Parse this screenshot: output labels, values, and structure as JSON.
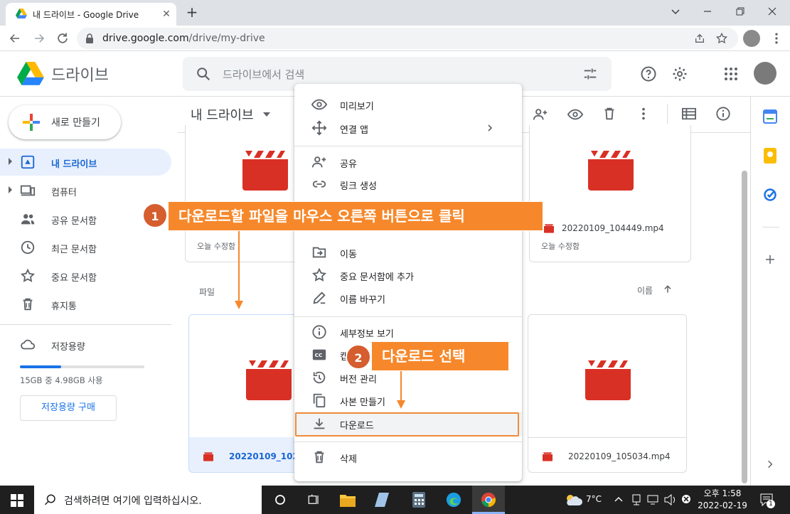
{
  "browser": {
    "tab_title": "내 드라이브 - Google Drive",
    "tab_close": "✕",
    "new_tab": "+",
    "url_host": "drive.google.com",
    "url_path": "/drive/my-drive"
  },
  "drive": {
    "logo_text": "드라이브",
    "search_placeholder": "드라이브에서 검색"
  },
  "sidebar": {
    "new_button": "새로 만들기",
    "items": [
      {
        "label": "내 드라이브",
        "icon": "my-drive-icon",
        "active": true
      },
      {
        "label": "컴퓨터",
        "icon": "computer-icon"
      },
      {
        "label": "공유 문서함",
        "icon": "shared-icon"
      },
      {
        "label": "최근 문서함",
        "icon": "clock-icon"
      },
      {
        "label": "중요 문서함",
        "icon": "star-icon"
      },
      {
        "label": "휴지통",
        "icon": "trash-icon"
      }
    ],
    "storage_label": "저장용량",
    "storage_text": "15GB 중 4.98GB 사용",
    "storage_fraction": 0.332,
    "buy_storage": "저장용량 구매"
  },
  "main": {
    "title": "내 드라이브",
    "section_label": "파일",
    "sort_label": "이름",
    "top_cards": [
      {
        "meta": "오늘 수정함"
      },
      {
        "name": "20220109_104449.mp4",
        "meta": "오늘 수정함"
      }
    ],
    "files": [
      {
        "name": "20220109_1021",
        "selected": true
      },
      {
        "name": "20220109_105034.mp4"
      }
    ]
  },
  "context_menu": {
    "items": [
      {
        "label": "미리보기",
        "icon": "eye-icon"
      },
      {
        "label": "연결 앱",
        "icon": "move-arrows-icon",
        "submenu": true
      },
      {
        "label": "공유",
        "icon": "person-add-icon"
      },
      {
        "label": "링크 생성",
        "icon": "link-icon"
      },
      {
        "label": "이동",
        "icon": "move-to-folder-icon"
      },
      {
        "label": "중요 문서함에 추가",
        "icon": "star-icon"
      },
      {
        "label": "이름 바꾸기",
        "icon": "pencil-icon"
      },
      {
        "label": "세부정보 보기",
        "icon": "info-icon"
      },
      {
        "label": "캡",
        "icon": "captions-icon"
      },
      {
        "label": "버전 관리",
        "icon": "history-icon"
      },
      {
        "label": "사본 만들기",
        "icon": "copy-icon"
      },
      {
        "label": "다운로드",
        "icon": "download-icon"
      },
      {
        "label": "삭제",
        "icon": "trash-icon"
      }
    ]
  },
  "annotations": {
    "step1_number": "1",
    "step1_text": "다운로드할 파일을 마우스 오른쪽 버튼으로 클릭",
    "step2_number": "2",
    "step2_text": "다운로드 선택",
    "accent_color": "#f6882b"
  },
  "taskbar": {
    "search_text": "검색하려면 여기에 입력하십시오.",
    "temperature": "7°C",
    "time": "오후 1:58",
    "date": "2022-02-19",
    "notification_count": "1"
  }
}
